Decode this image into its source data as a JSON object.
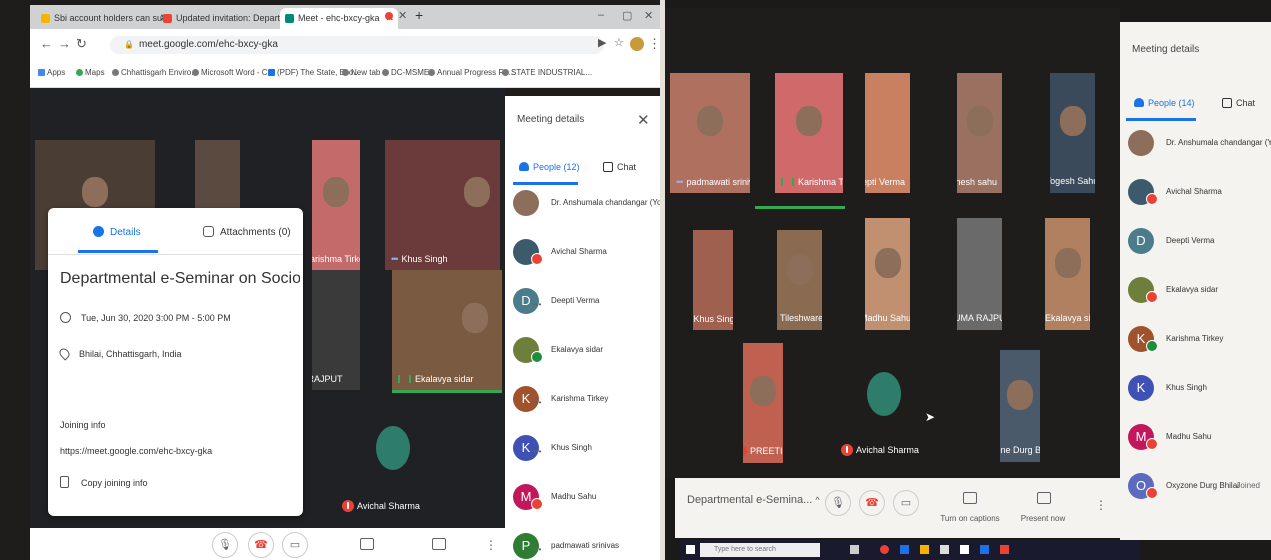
{
  "left": {
    "browser": {
      "tabs": [
        {
          "label": "Sbi account holders can submit",
          "color": "#f4b400"
        },
        {
          "label": "Updated invitation: Departmen",
          "color": "#ea4335"
        },
        {
          "label": "Meet - ehc-bxcy-gka",
          "color": "#00897b"
        }
      ],
      "url": "meet.google.com/ehc-bxcy-gka",
      "bookmarks": [
        "Apps",
        "Maps",
        "Chhattisgarh Enviro...",
        "Microsoft Word - C...",
        "(PDF) The State, Eco...",
        "New tab",
        "DC-MSME",
        "Annual Progress Re...",
        "STATE INDUSTRIAL..."
      ]
    },
    "tiles": [
      {
        "name": "Karishma Tirkey",
        "indicator": "none"
      },
      {
        "name": "Khus Singh",
        "indicator": "dots"
      },
      {
        "name": "MA RAJPUT",
        "indicator": "none"
      },
      {
        "name": "Ekalavya sidar",
        "indicator": "speaking"
      },
      {
        "name": "Avichal Sharma",
        "indicator": "mic-off"
      }
    ],
    "details": {
      "tab_details": "Details",
      "tab_attachments": "Attachments (0)",
      "title": "Departmental e-Seminar on Socio-Economic ...",
      "datetime": "Tue, Jun 30, 2020 3:00 PM - 5:00 PM",
      "location": "Bhilai, Chhattisgarh, India",
      "joining_label": "Joining info",
      "joining_url": "https://meet.google.com/ehc-bxcy-gka",
      "copy_label": "Copy joining info"
    },
    "sidebar": {
      "title": "Meeting details",
      "people_tab": "People (12)",
      "chat_tab": "Chat",
      "people": [
        {
          "name": "Dr. Anshumala chandangar (Yo...",
          "initial": "",
          "color": "#8d6e5a",
          "badge": "none"
        },
        {
          "name": "Avichal Sharma",
          "initial": "",
          "color": "#3d5a6c",
          "badge": "mic-off"
        },
        {
          "name": "Deepti Verma",
          "initial": "D",
          "color": "#4a7c8c",
          "badge": "more"
        },
        {
          "name": "Ekalavya sidar",
          "initial": "",
          "color": "#6d7f3a",
          "badge": "speaking"
        },
        {
          "name": "Karishma Tirkey",
          "initial": "K",
          "color": "#a0522d",
          "badge": "more"
        },
        {
          "name": "Khus Singh",
          "initial": "K",
          "color": "#3f51b5",
          "badge": "more"
        },
        {
          "name": "Madhu Sahu",
          "initial": "M",
          "color": "#c2185b",
          "badge": "mic-off"
        },
        {
          "name": "padmawati srinivas",
          "initial": "P",
          "color": "#2e7d32",
          "badge": "more"
        }
      ]
    }
  },
  "right": {
    "tiles": [
      {
        "name": "padmawati srinivas",
        "indicator": "dots"
      },
      {
        "name": "Karishma Tirkey",
        "indicator": "speaking"
      },
      {
        "name": "Deepti Verma",
        "indicator": "dots"
      },
      {
        "name": "Shesh sahu",
        "indicator": "dots"
      },
      {
        "name": "Yogesh Sahu",
        "indicator": "mic-off"
      },
      {
        "name": "Khus Singh",
        "indicator": "dots"
      },
      {
        "name": "Tileshwaree Thakur",
        "indicator": "mic-off"
      },
      {
        "name": "Madhu Sahu",
        "indicator": "mic-off"
      },
      {
        "name": "UMA RAJPUT",
        "indicator": "mic-off"
      },
      {
        "name": "Ekalavya sidar",
        "indicator": "mic-off"
      },
      {
        "name": "PREETI SINGH",
        "indicator": "mic-off"
      },
      {
        "name": "Avichal Sharma",
        "indicator": "mic-off"
      },
      {
        "name": "Oxyzone Durg Bhilai",
        "indicator": "mic-off"
      }
    ],
    "sidebar": {
      "title": "Meeting details",
      "people_tab": "People (14)",
      "chat_tab": "Chat",
      "joined_label": "Joined",
      "people": [
        {
          "name": "Dr. Anshumala chandangar (Yo...",
          "initial": "",
          "color": "#8d6e5a",
          "badge": "none"
        },
        {
          "name": "Avichal Sharma",
          "initial": "",
          "color": "#3d5a6c",
          "badge": "mic-off"
        },
        {
          "name": "Deepti Verma",
          "initial": "D",
          "color": "#4a7c8c",
          "badge": "none"
        },
        {
          "name": "Ekalavya sidar",
          "initial": "",
          "color": "#6d7f3a",
          "badge": "mic-off"
        },
        {
          "name": "Karishma Tirkey",
          "initial": "K",
          "color": "#a0522d",
          "badge": "speaking"
        },
        {
          "name": "Khus Singh",
          "initial": "K",
          "color": "#3f51b5",
          "badge": "none"
        },
        {
          "name": "Madhu Sahu",
          "initial": "M",
          "color": "#c2185b",
          "badge": "mic-off"
        },
        {
          "name": "Oxyzone Durg Bhilai",
          "initial": "O",
          "color": "#5c6bc0",
          "badge": "mic-off"
        }
      ]
    },
    "bottom": {
      "title": "Departmental e-Semina...",
      "captions_label": "Turn on captions",
      "present_label": "Present now"
    },
    "taskbar_search": "Type here to search"
  }
}
